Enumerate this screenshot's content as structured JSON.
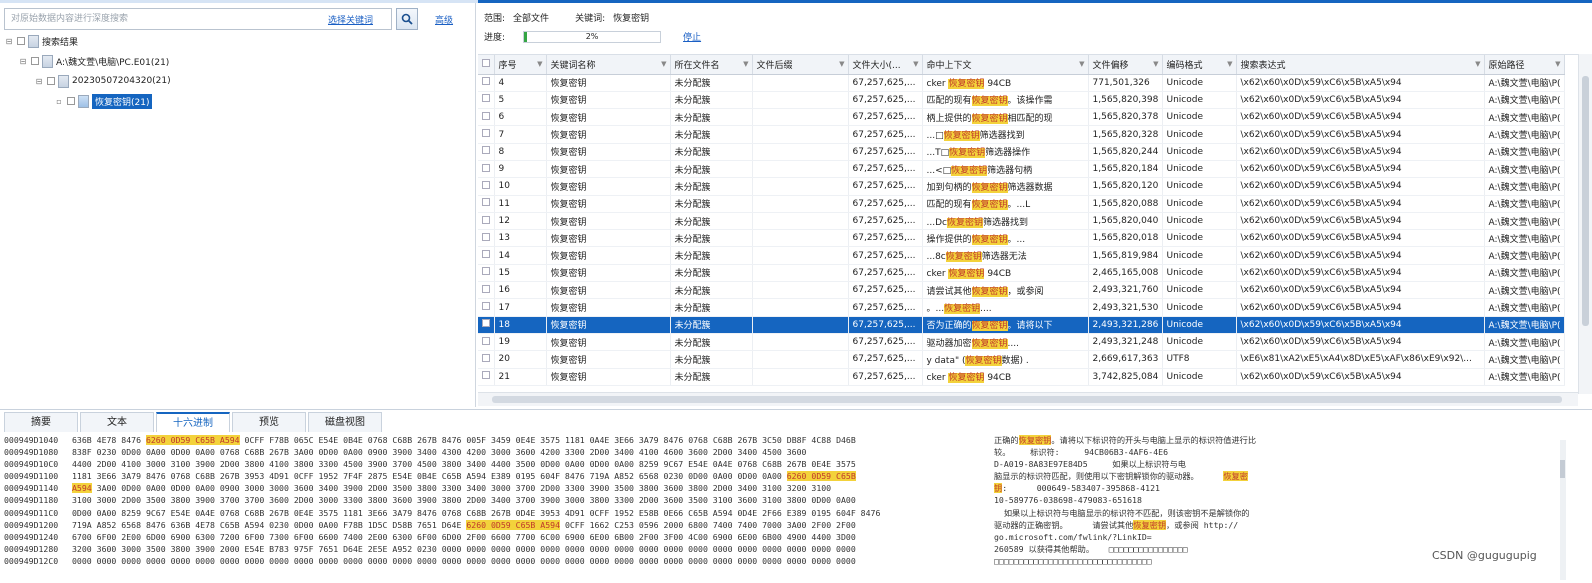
{
  "left_panel": {
    "search_placeholder": "对原始数据内容进行深度搜索",
    "keyword_link": "选择关键词",
    "advanced_link": "高级",
    "tree": [
      {
        "label": "搜索结果",
        "level": 0,
        "glyph": "⊟"
      },
      {
        "label": "A:\\魏文萱\\电脑\\PC.E01(21)",
        "level": 1,
        "glyph": "⊟"
      },
      {
        "label": "20230507204320(21)",
        "level": 2,
        "glyph": "⊟"
      },
      {
        "label": "恢复密钥(21)",
        "level": 3,
        "glyph": "",
        "selected": true
      }
    ]
  },
  "right_panel": {
    "scope_label": "范围:",
    "scope_value": "全部文件",
    "keyword_label": "关键词:",
    "keyword_value": "恢复密钥",
    "progress_label": "进度:",
    "progress_text": "2%",
    "progress_fraction": 0.02,
    "stop_link": "停止",
    "accent": "#1565c0",
    "columns": [
      "序号",
      "关键词名称",
      "所在文件名",
      "文件后缀",
      "文件大小(...",
      "命中上下文",
      "文件偏移",
      "编码格式",
      "搜索表达式",
      "原始路径"
    ],
    "rows": [
      {
        "no": "4",
        "kw": "恢复密钥",
        "file": "未分配簇",
        "ext": "",
        "size": "67,257,625,...",
        "ctx_pre": "cker ",
        "ctx_hit": "恢复密钥",
        "ctx_post": " 94CB",
        "offset": "771,501,326",
        "enc": "Unicode",
        "expr": "\\x62\\x60\\x0D\\x59\\xC6\\x5B\\xA5\\x94",
        "path": "A:\\魏文萱\\电脑\\P("
      },
      {
        "no": "5",
        "kw": "恢复密钥",
        "file": "未分配簇",
        "ext": "",
        "size": "67,257,625,...",
        "ctx_pre": "匹配的现有",
        "ctx_hit": "恢复密钥",
        "ctx_post": "。该操作需",
        "offset": "1,565,820,398",
        "enc": "Unicode",
        "expr": "\\x62\\x60\\x0D\\x59\\xC6\\x5B\\xA5\\x94",
        "path": "A:\\魏文萱\\电脑\\P("
      },
      {
        "no": "6",
        "kw": "恢复密钥",
        "file": "未分配簇",
        "ext": "",
        "size": "67,257,625,...",
        "ctx_pre": "柄上提供的",
        "ctx_hit": "恢复密钥",
        "ctx_post": "相匹配的现",
        "offset": "1,565,820,378",
        "enc": "Unicode",
        "expr": "\\x62\\x60\\x0D\\x59\\xC6\\x5B\\xA5\\x94",
        "path": "A:\\魏文萱\\电脑\\P("
      },
      {
        "no": "7",
        "kw": "恢复密钥",
        "file": "未分配簇",
        "ext": "",
        "size": "67,257,625,...",
        "ctx_pre": "...□",
        "ctx_hit": "恢复密钥",
        "ctx_post": "筛选器找到",
        "offset": "1,565,820,328",
        "enc": "Unicode",
        "expr": "\\x62\\x60\\x0D\\x59\\xC6\\x5B\\xA5\\x94",
        "path": "A:\\魏文萱\\电脑\\P("
      },
      {
        "no": "8",
        "kw": "恢复密钥",
        "file": "未分配簇",
        "ext": "",
        "size": "67,257,625,...",
        "ctx_pre": "...T□",
        "ctx_hit": "恢复密钥",
        "ctx_post": "筛选器操作",
        "offset": "1,565,820,244",
        "enc": "Unicode",
        "expr": "\\x62\\x60\\x0D\\x59\\xC6\\x5B\\xA5\\x94",
        "path": "A:\\魏文萱\\电脑\\P("
      },
      {
        "no": "9",
        "kw": "恢复密钥",
        "file": "未分配簇",
        "ext": "",
        "size": "67,257,625,...",
        "ctx_pre": "...<□",
        "ctx_hit": "恢复密钥",
        "ctx_post": "筛选器句柄",
        "offset": "1,565,820,184",
        "enc": "Unicode",
        "expr": "\\x62\\x60\\x0D\\x59\\xC6\\x5B\\xA5\\x94",
        "path": "A:\\魏文萱\\电脑\\P("
      },
      {
        "no": "10",
        "kw": "恢复密钥",
        "file": "未分配簇",
        "ext": "",
        "size": "67,257,625,...",
        "ctx_pre": "加到句柄的",
        "ctx_hit": "恢复密钥",
        "ctx_post": "筛选器数据",
        "offset": "1,565,820,120",
        "enc": "Unicode",
        "expr": "\\x62\\x60\\x0D\\x59\\xC6\\x5B\\xA5\\x94",
        "path": "A:\\魏文萱\\电脑\\P("
      },
      {
        "no": "11",
        "kw": "恢复密钥",
        "file": "未分配簇",
        "ext": "",
        "size": "67,257,625,...",
        "ctx_pre": "匹配的现有",
        "ctx_hit": "恢复密钥",
        "ctx_post": "。...L",
        "offset": "1,565,820,088",
        "enc": "Unicode",
        "expr": "\\x62\\x60\\x0D\\x59\\xC6\\x5B\\xA5\\x94",
        "path": "A:\\魏文萱\\电脑\\P("
      },
      {
        "no": "12",
        "kw": "恢复密钥",
        "file": "未分配簇",
        "ext": "",
        "size": "67,257,625,...",
        "ctx_pre": "...Dc",
        "ctx_hit": "恢复密钥",
        "ctx_post": "筛选器找到",
        "offset": "1,565,820,040",
        "enc": "Unicode",
        "expr": "\\x62\\x60\\x0D\\x59\\xC6\\x5B\\xA5\\x94",
        "path": "A:\\魏文萱\\电脑\\P("
      },
      {
        "no": "13",
        "kw": "恢复密钥",
        "file": "未分配簇",
        "ext": "",
        "size": "67,257,625,...",
        "ctx_pre": "操作提供的",
        "ctx_hit": "恢复密钥",
        "ctx_post": "。...",
        "offset": "1,565,820,018",
        "enc": "Unicode",
        "expr": "\\x62\\x60\\x0D\\x59\\xC6\\x5B\\xA5\\x94",
        "path": "A:\\魏文萱\\电脑\\P("
      },
      {
        "no": "14",
        "kw": "恢复密钥",
        "file": "未分配簇",
        "ext": "",
        "size": "67,257,625,...",
        "ctx_pre": "...8c",
        "ctx_hit": "恢复密钥",
        "ctx_post": "筛选器无法",
        "offset": "1,565,819,984",
        "enc": "Unicode",
        "expr": "\\x62\\x60\\x0D\\x59\\xC6\\x5B\\xA5\\x94",
        "path": "A:\\魏文萱\\电脑\\P("
      },
      {
        "no": "15",
        "kw": "恢复密钥",
        "file": "未分配簇",
        "ext": "",
        "size": "67,257,625,...",
        "ctx_pre": "cker ",
        "ctx_hit": "恢复密钥",
        "ctx_post": " 94CB",
        "offset": "2,465,165,008",
        "enc": "Unicode",
        "expr": "\\x62\\x60\\x0D\\x59\\xC6\\x5B\\xA5\\x94",
        "path": "A:\\魏文萱\\电脑\\P("
      },
      {
        "no": "16",
        "kw": "恢复密钥",
        "file": "未分配簇",
        "ext": "",
        "size": "67,257,625,...",
        "ctx_pre": "请尝试其他",
        "ctx_hit": "恢复密钥",
        "ctx_post": "，或参阅",
        "offset": "2,493,321,760",
        "enc": "Unicode",
        "expr": "\\x62\\x60\\x0D\\x59\\xC6\\x5B\\xA5\\x94",
        "path": "A:\\魏文萱\\电脑\\P("
      },
      {
        "no": "17",
        "kw": "恢复密钥",
        "file": "未分配簇",
        "ext": "",
        "size": "67,257,625,...",
        "ctx_pre": "。...",
        "ctx_hit": "恢复密钥",
        "ctx_post": "....",
        "offset": "2,493,321,530",
        "enc": "Unicode",
        "expr": "\\x62\\x60\\x0D\\x59\\xC6\\x5B\\xA5\\x94",
        "path": "A:\\魏文萱\\电脑\\P("
      },
      {
        "no": "18",
        "kw": "恢复密钥",
        "file": "未分配簇",
        "ext": "",
        "size": "67,257,625,...",
        "ctx_pre": "否为正确的",
        "ctx_hit": "恢复密钥",
        "ctx_post": "。请将以下",
        "offset": "2,493,321,286",
        "enc": "Unicode",
        "expr": "\\x62\\x60\\x0D\\x59\\xC6\\x5B\\xA5\\x94",
        "path": "A:\\魏文萱\\电脑\\P(",
        "selected": true
      },
      {
        "no": "19",
        "kw": "恢复密钥",
        "file": "未分配簇",
        "ext": "",
        "size": "67,257,625,...",
        "ctx_pre": "驱动器加密",
        "ctx_hit": "恢复密钥",
        "ctx_post": "....",
        "offset": "2,493,321,248",
        "enc": "Unicode",
        "expr": "\\x62\\x60\\x0D\\x59\\xC6\\x5B\\xA5\\x94",
        "path": "A:\\魏文萱\\电脑\\P("
      },
      {
        "no": "20",
        "kw": "恢复密钥",
        "file": "未分配簇",
        "ext": "",
        "size": "67,257,625,...",
        "ctx_pre": "y data\" (",
        "ctx_hit": "恢复密钥",
        "ctx_post": "数据) .",
        "offset": "2,669,617,363",
        "enc": "UTF8",
        "expr": "\\xE6\\x81\\xA2\\xE5\\xA4\\x8D\\xE5\\xAF\\x86\\xE9\\x92\\...",
        "path": "A:\\魏文萱\\电脑\\P("
      },
      {
        "no": "21",
        "kw": "恢复密钥",
        "file": "未分配簇",
        "ext": "",
        "size": "67,257,625,...",
        "ctx_pre": "cker ",
        "ctx_hit": "恢复密钥",
        "ctx_post": " 94CB",
        "offset": "3,742,825,084",
        "enc": "Unicode",
        "expr": "\\x62\\x60\\x0D\\x59\\xC6\\x5B\\xA5\\x94",
        "path": "A:\\魏文萱\\电脑\\P("
      }
    ]
  },
  "bottom_panel": {
    "tabs": [
      "摘要",
      "文本",
      "十六进制",
      "预览",
      "磁盘视图"
    ],
    "active_tab": "十六进制",
    "hex_lines": [
      {
        "off": "000949D1040",
        "bytes": "636B 4E78 8476 [6260 0D59 C65B A594] 0CFF F78B 065C E54E 0B4E 0768 C68B 267B 8476 005F 3459 0E4E 3575 1181 0A4E 3E66 3A79 8476 0768 C68B 267B 3C50 DB8F 4C88 D46B",
        "text": "正确的[恢复密钥]。请将以下标识符的开头与电脑上显示的标识符值进行比"
      },
      {
        "off": "000949D1080",
        "bytes": "838F 0230 0D00 0A00 0D00 0A00 0768 C68B 267B 3A00 0D00 0A00 0900 3900 3400 4300 4200 3000 3600 4200 3300 2D00 3400 4100 4600 3600 2D00 3400 4500 3600",
        "text": "较。    标识符:     94CB06B3-4AF6-4E6"
      },
      {
        "off": "000949D10C0",
        "bytes": "4400 2D00 4100 3000 3100 3900 2D00 3800 4100 3800 3300 4500 3900 3700 4500 3800 3400 4400 3500 0D00 0A00 0D00 0A00 8259 9C67 E54E 0A4E 0768 C68B 267B 0E4E 3575",
        "text": "D-A019-8A83E97E84D5     如果以上标识符与电"
      },
      {
        "off": "000949D1100",
        "bytes": "1181 3E66 3A79 8476 0768 C68B 267B 3953 4D91 0CFF 1952 7F4F 2875 E54E 0B4E C65B A594 E389 0195 604F 8476 719A A852 6568 0230 0D00 0A00 0D00 0A00 [6260 0D59 C65B]",
        "text": "脑显示的标识符匹配，则使用以下密钥解锁你的驱动器。     [恢复密]"
      },
      {
        "off": "000949D1140",
        "bytes": "[A594] 3A00 0D00 0A00 0D00 0A00 0900 3000 3000 3600 3400 3900 2D00 3500 3800 3300 3400 3000 3700 2D00 3300 3900 3500 3800 3600 3800 2D00 3400 3100 3200 3100",
        "text": "[钥]:      000649-583407-395868-4121"
      },
      {
        "off": "000949D1180",
        "bytes": "3100 3000 2D00 3500 3800 3900 3700 3700 3600 2D00 3000 3300 3800 3600 3900 3800 2D00 3400 3700 3900 3000 3800 3300 2D00 3600 3500 3100 3600 3100 3800 0D00 0A00",
        "text": "10-589776-038698-479083-651618"
      },
      {
        "off": "000949D11C0",
        "bytes": "0D00 0A00 8259 9C67 E54E 0A4E 0768 C68B 267B 0E4E 3575 1181 3E66 3A79 8476 0768 C68B 267B 0D4E 3953 4D91 0CFF 1952 E58B 0E66 C65B A594 0D4E 2F66 E389 0195 604F 8476",
        "text": "  如果以上标识符与电脑显示的标识符不匹配，则该密钥不是解锁你的"
      },
      {
        "off": "000949D1200",
        "bytes": "719A A852 6568 8476 636B 4E78 C65B A594 0230 0D00 0A00 F78B 1D5C D58B 7651 D64E [6260 0D59 C65B A594] 0CFF 1662 C253 0596 2000 6800 7400 7400 7000 3A00 2F00 2F00",
        "text": "驱动器的正确密钥。     请尝试其他[恢复密钥]，或参阅 http://"
      },
      {
        "off": "000949D1240",
        "bytes": "6700 6F00 2E00 6D00 6900 6300 7200 6F00 7300 6F00 6600 7400 2E00 6300 6F00 6D00 2F00 6600 7700 6C00 6900 6E00 6B00 2F00 3F00 4C00 6900 6E00 6B00 4900 4400 3D00",
        "text": "go.microsoft.com/fwlink/?LinkID="
      },
      {
        "off": "000949D1280",
        "bytes": "3200 3600 3000 3500 3800 3900 2000 E54E B783 975F 7651 D64E 2E5E A952 0230 0000 0000 0000 0000 0000 0000 0000 0000 0000 0000 0000 0000 0000 0000 0000 0000 0000",
        "text": "260589 以获得其他帮助。   □□□□□□□□□□□□□□□□"
      },
      {
        "off": "000949D12C0",
        "bytes": "0000 0000 0000 0000 0000 0000 0000 0000 0000 0000 0000 0000 0000 0000 0000 0000 0000 0000 0000 0000 0000 0000 0000 0000 0000 0000 0000 0000 0000 0000 0000 0000",
        "text": "□□□□□□□□□□□□□□□□□□□□□□□□□□□□□□□□"
      }
    ]
  },
  "watermark": "CSDN @gugugupig",
  "highlight_color": "#f3d23b",
  "selection_color": "#1565c0"
}
